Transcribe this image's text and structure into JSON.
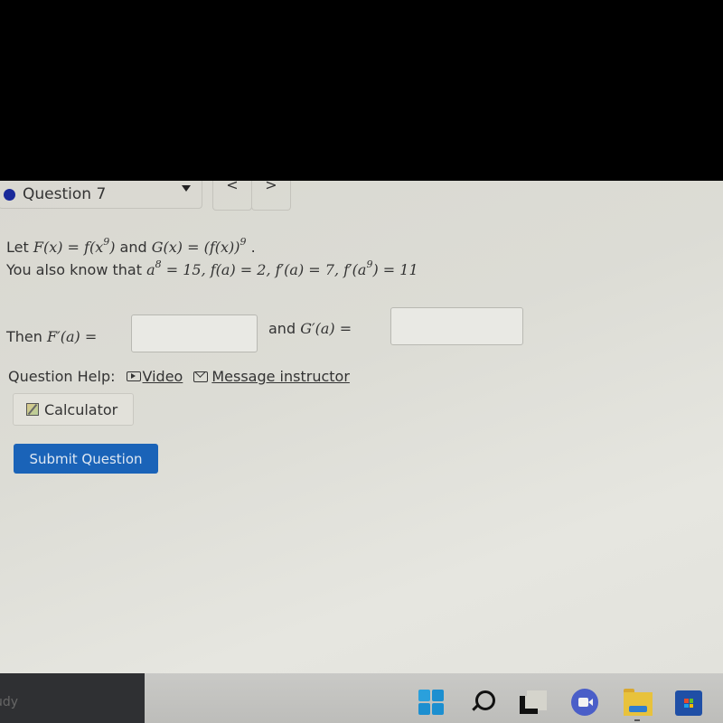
{
  "question_nav": {
    "current_question": "Question 7",
    "status_color": "#1a2a9a",
    "prev_label": "<",
    "next_label": ">"
  },
  "problem": {
    "line1": {
      "prefix": "Let ",
      "F_def_lhs": "F(x)",
      "eq1": " = ",
      "F_def_rhs_pre": "f(x",
      "F_def_rhs_exp": "9",
      "F_def_rhs_post": ")",
      "and": " and ",
      "G_def_lhs": "G(x)",
      "eq2": " = ",
      "G_def_rhs": "(f(x))",
      "G_def_exp": "9",
      "suffix": " ."
    },
    "line2": {
      "prefix": "You also know that ",
      "a_base": "a",
      "a_exp": "8",
      "given1_rest": " = 15,  ",
      "given2": "f(a) = 2,  ",
      "given3": "f′(a) = 7,  ",
      "given4_pre": "f′(a",
      "given4_exp": "9",
      "given4_post": ") = 11"
    }
  },
  "answers": {
    "then_prefix": "Then ",
    "F_prime": "F′(a)",
    "equals": " =",
    "and_prefix": "and ",
    "G_prime": "G′(a)",
    "answer1_value": "",
    "answer2_value": ""
  },
  "help": {
    "label": "Question Help:",
    "video_label": "Video",
    "message_label": "Message instructor",
    "calculator_label": "Calculator"
  },
  "submit_label": "Submit Question",
  "taskbar": {
    "left_text": "udy",
    "icons": [
      "windows-start-icon",
      "search-icon",
      "task-view-icon",
      "meet-chat-icon",
      "file-explorer-icon",
      "microsoft-store-icon"
    ]
  }
}
